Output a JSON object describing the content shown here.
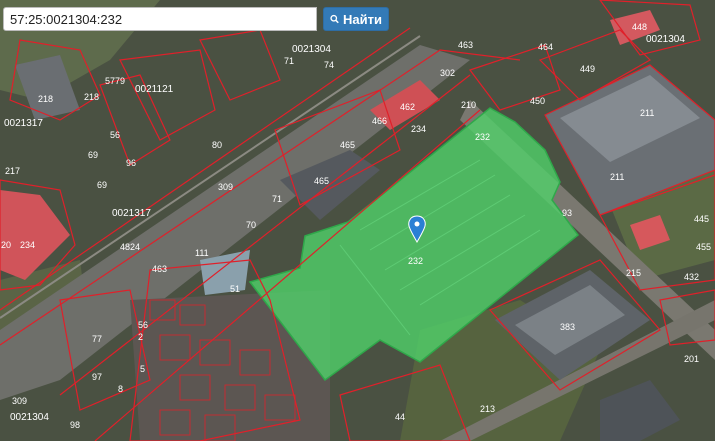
{
  "search": {
    "value": "57:25:0021304:232",
    "button_label": "Найти"
  },
  "selected_parcel": {
    "label": "232",
    "fill": "#4fd36a",
    "stroke": "#2fa84a"
  },
  "quarters": [
    "0021304",
    "0021317",
    "0021317",
    "0021304",
    "0021304",
    "0021121"
  ],
  "parcel_labels": [
    "218",
    "217",
    "234",
    "20",
    "5779",
    "56",
    "96",
    "69",
    "80",
    "71",
    "74",
    "463",
    "464",
    "448",
    "445",
    "449",
    "450",
    "210",
    "232",
    "234",
    "466",
    "462",
    "211",
    "211",
    "309",
    "71",
    "465",
    "465",
    "70",
    "111",
    "51",
    "4824",
    "463",
    "69",
    "218",
    "97",
    "77",
    "56",
    "2",
    "5",
    "8",
    "309",
    "98",
    "44",
    "213",
    "201",
    "455",
    "215",
    "432",
    "383",
    "93",
    "302"
  ],
  "colors": {
    "boundary": "#e0202a",
    "pin": "#2a7fd4"
  },
  "icons": [
    "search-icon",
    "map-pin-icon"
  ]
}
